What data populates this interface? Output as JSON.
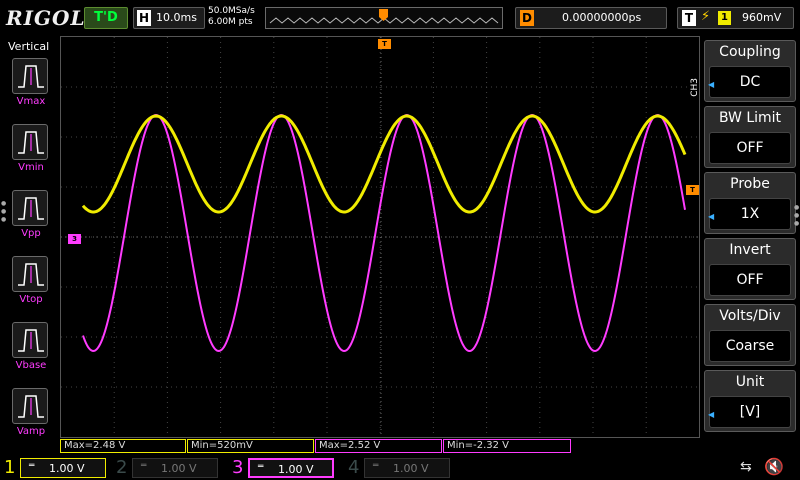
{
  "topbar": {
    "logo": "RIGOL",
    "run_status": "T'D",
    "timebase_label": "H",
    "timebase_value": "10.0ms",
    "sample_rate": "50.0MSa/s",
    "memory_depth": "6.00M pts",
    "delay_label": "D",
    "delay_value": "0.00000000ps",
    "trigger_label": "T",
    "trigger_source": "1",
    "trigger_level": "960mV"
  },
  "leftbar": {
    "title": "Vertical",
    "items": [
      {
        "label": "Vmax",
        "icon": "vmax-icon"
      },
      {
        "label": "Vmin",
        "icon": "vmin-icon"
      },
      {
        "label": "Vpp",
        "icon": "vpp-icon"
      },
      {
        "label": "Vtop",
        "icon": "vtop-icon"
      },
      {
        "label": "Vbase",
        "icon": "vbase-icon"
      },
      {
        "label": "Vamp",
        "icon": "vamp-icon"
      }
    ]
  },
  "grid": {
    "channel3_marker": "3",
    "trigger_top_marker": "T",
    "trigger_level_marker": "T"
  },
  "rightmenu": {
    "channel_tag": "CH3",
    "items": [
      {
        "title": "Coupling",
        "value": "DC"
      },
      {
        "title": "BW Limit",
        "value": "OFF"
      },
      {
        "title": "Probe",
        "value": "1X"
      },
      {
        "title": "Invert",
        "value": "OFF"
      },
      {
        "title": "Volts/Div",
        "value": "Coarse"
      },
      {
        "title": "Unit",
        "value": "[V]"
      }
    ]
  },
  "measurements": [
    {
      "text": "Max=2.48 V",
      "color": "#f0ec00"
    },
    {
      "text": "Min=520mV",
      "color": "#f0ec00"
    },
    {
      "text": "Max=2.52 V",
      "color": "#ff3cff"
    },
    {
      "text": "Min=-2.32 V",
      "color": "#ff3cff"
    }
  ],
  "channels": [
    {
      "num": "1",
      "coupling": "═",
      "scale": "1.00 V",
      "color": "#f0ec00",
      "active": true
    },
    {
      "num": "2",
      "coupling": "═",
      "scale": "1.00 V",
      "color": "#1aa3a3",
      "active": false
    },
    {
      "num": "3",
      "coupling": "═",
      "scale": "1.00 V",
      "color": "#ff3cff",
      "active": true
    },
    {
      "num": "4",
      "coupling": "═",
      "scale": "1.00 V",
      "color": "#3a6aff",
      "active": false
    }
  ],
  "colors": {
    "ch1": "#f0ec00",
    "ch3": "#ff3cff",
    "trigger": "#ff8c00"
  }
}
